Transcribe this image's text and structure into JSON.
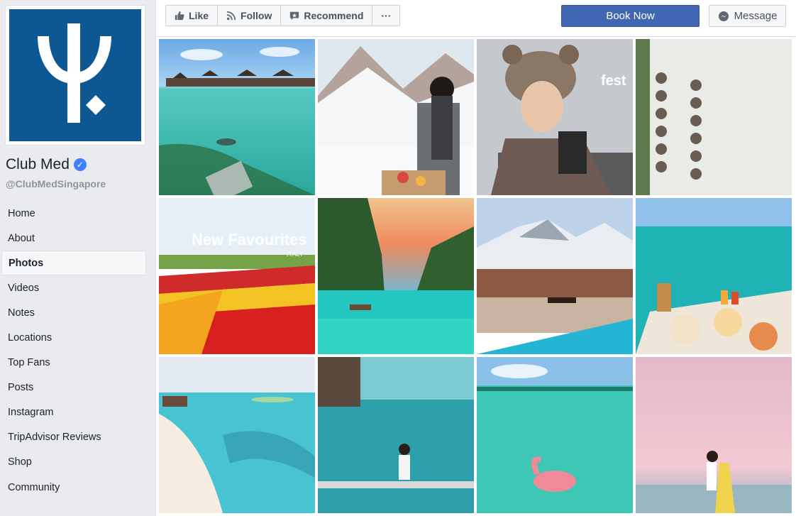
{
  "page": {
    "name": "Club Med",
    "handle": "@ClubMedSingapore",
    "verified_mark": "✓"
  },
  "nav": {
    "items": [
      "Home",
      "About",
      "Photos",
      "Videos",
      "Notes",
      "Locations",
      "Top Fans",
      "Posts",
      "Instagram",
      "TripAdvisor Reviews",
      "Shop",
      "Community"
    ],
    "active": "Photos"
  },
  "actions": {
    "like": "Like",
    "follow": "Follow",
    "recommend": "Recommend",
    "more": "···",
    "book_now": "Book Now",
    "message": "Message"
  },
  "photos": {
    "overlay_fest": "fest",
    "overlay_new": "New Favourites",
    "overlay_italy": "ITALY"
  },
  "colors": {
    "brand_blue": "#0d5792",
    "button_blue": "#4267b2",
    "verified": "#4080ff"
  }
}
